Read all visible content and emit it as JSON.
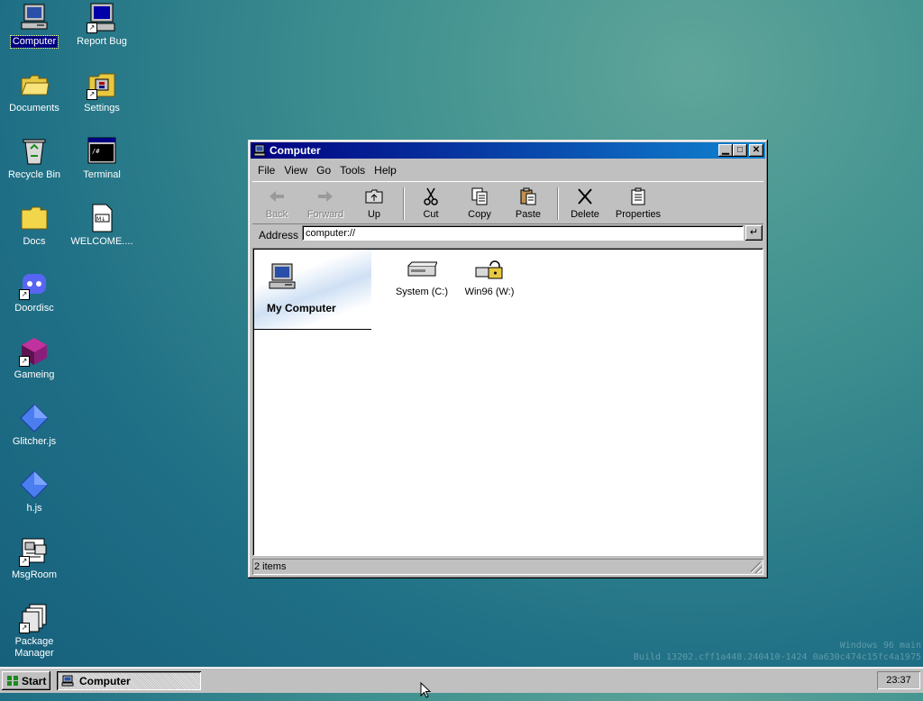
{
  "desktop": {
    "icons": [
      {
        "label": "Computer",
        "icon": "computer-icon"
      },
      {
        "label": "Report Bug",
        "icon": "report-bug-icon"
      },
      {
        "label": "Documents",
        "icon": "folder-open-icon"
      },
      {
        "label": "Settings",
        "icon": "settings-icon"
      },
      {
        "label": "Recycle Bin",
        "icon": "recycle-bin-icon"
      },
      {
        "label": "Terminal",
        "icon": "terminal-icon"
      },
      {
        "label": "Docs",
        "icon": "folder-icon"
      },
      {
        "label": "WELCOME....",
        "icon": "markdown-file-icon"
      },
      {
        "label": "Doordisc",
        "icon": "doordisc-icon"
      },
      {
        "label": "Gameing",
        "icon": "gameing-icon"
      },
      {
        "label": "Glitcher.js",
        "icon": "js-diamond-icon"
      },
      {
        "label": "h.js",
        "icon": "js-diamond-icon"
      },
      {
        "label": "MsgRoom",
        "icon": "msgroom-icon"
      },
      {
        "label": "Package Manager",
        "icon": "package-manager-icon"
      }
    ],
    "watermark": {
      "line1": "Windows 96 main",
      "line2": "Build 13202.cff1a448.240410-1424 0a630c474c15fc4a1975"
    }
  },
  "window": {
    "title": "Computer",
    "menu": [
      "File",
      "View",
      "Go",
      "Tools",
      "Help"
    ],
    "toolbar": {
      "back": "Back",
      "forward": "Forward",
      "up": "Up",
      "cut": "Cut",
      "copy": "Copy",
      "paste": "Paste",
      "delete": "Delete",
      "properties": "Properties"
    },
    "address": {
      "label": "Address",
      "value": "computer://"
    },
    "banner_title": "My Computer",
    "items": [
      {
        "label": "System (C:)",
        "icon": "hard-drive-icon"
      },
      {
        "label": "Win96 (W:)",
        "icon": "locked-drive-icon"
      }
    ],
    "status": "2 items"
  },
  "taskbar": {
    "start": "Start",
    "task": "Computer",
    "clock": "23:37"
  },
  "colors": {
    "titlebar_start": "#000080",
    "titlebar_end": "#1084d0",
    "face": "#c0c0c0",
    "desktop": "#2f8189"
  }
}
